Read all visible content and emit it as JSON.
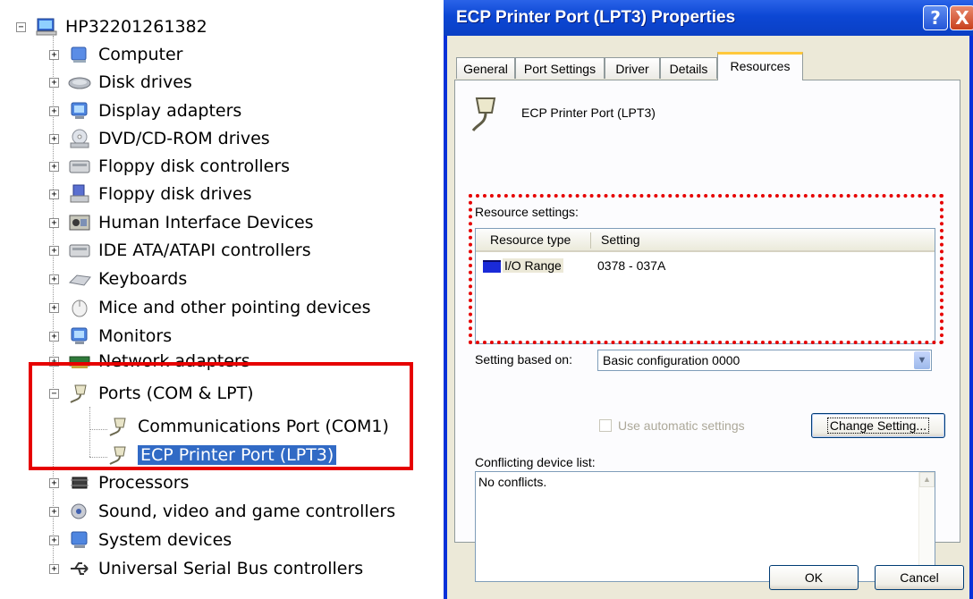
{
  "tree": {
    "root": "HP32201261382",
    "items": [
      {
        "label": "Computer",
        "icon": "computer-icon"
      },
      {
        "label": "Disk drives",
        "icon": "disk-drive-icon"
      },
      {
        "label": "Display adapters",
        "icon": "display-adapter-icon"
      },
      {
        "label": "DVD/CD-ROM drives",
        "icon": "cdrom-icon"
      },
      {
        "label": "Floppy disk controllers",
        "icon": "controller-icon"
      },
      {
        "label": "Floppy disk drives",
        "icon": "floppy-icon"
      },
      {
        "label": "Human Interface Devices",
        "icon": "hid-icon"
      },
      {
        "label": "IDE ATA/ATAPI controllers",
        "icon": "ide-controller-icon"
      },
      {
        "label": "Keyboards",
        "icon": "keyboard-icon"
      },
      {
        "label": "Mice and other pointing devices",
        "icon": "mouse-icon"
      },
      {
        "label": "Monitors",
        "icon": "monitor-icon"
      },
      {
        "label": "Network adapters",
        "icon": "network-adapter-icon"
      },
      {
        "label": "Ports (COM & LPT)",
        "icon": "port-icon"
      },
      {
        "label": "Communications Port (COM1)",
        "icon": "port-icon"
      },
      {
        "label": "ECP Printer Port (LPT3)",
        "icon": "port-icon"
      },
      {
        "label": "Processors",
        "icon": "processor-icon"
      },
      {
        "label": "Sound, video and game controllers",
        "icon": "sound-icon"
      },
      {
        "label": "System devices",
        "icon": "system-device-icon"
      },
      {
        "label": "Universal Serial Bus controllers",
        "icon": "usb-icon"
      }
    ]
  },
  "dialog": {
    "title": "ECP Printer Port (LPT3) Properties",
    "help_glyph": "?",
    "close_glyph": "X",
    "tabs": [
      "General",
      "Port Settings",
      "Driver",
      "Details",
      "Resources"
    ],
    "active_tab": "Resources",
    "device_name": "ECP Printer Port (LPT3)",
    "resource_settings_label": "Resource settings:",
    "columns": [
      "Resource type",
      "Setting"
    ],
    "resources": [
      {
        "type": "I/O Range",
        "setting": "0378 - 037A"
      }
    ],
    "setting_based_on_label": "Setting based on:",
    "setting_based_on_value": "Basic configuration 0000",
    "use_automatic_label": "Use automatic settings",
    "change_setting_label": "Change Setting...",
    "conflicting_label": "Conflicting device list:",
    "conflicts_text": "No conflicts.",
    "ok_label": "OK",
    "cancel_label": "Cancel"
  },
  "colors": {
    "highlight_red": "#e60000",
    "title_blue": "#0c47d4",
    "selection_blue": "#316ac5"
  }
}
